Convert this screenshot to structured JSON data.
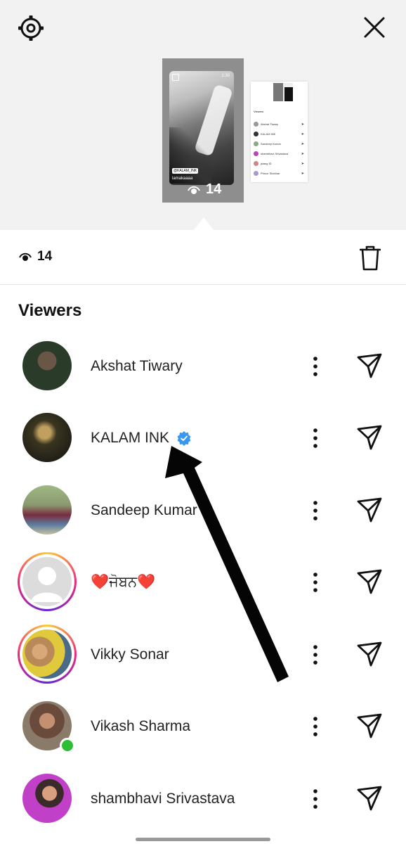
{
  "story": {
    "views": "14",
    "tag": "@KALAM_INK",
    "user": "lamakaaaa",
    "time": "1:30"
  },
  "mini_preview": {
    "title": "Viewers",
    "items": [
      "Akshat Tiwary",
      "KALAM INK",
      "Sandeep Kumar",
      "shambhavi Srivastava",
      "jsiang ID",
      "Prince Shekhar"
    ]
  },
  "stats": {
    "views": "14"
  },
  "viewers_title": "Viewers",
  "viewers": [
    {
      "name": "Akshat Tiwary",
      "verified": false,
      "ring": false,
      "online": false,
      "avatar_color": "#4a5a45"
    },
    {
      "name": "KALAM INK",
      "verified": true,
      "ring": false,
      "online": false,
      "avatar_color": "#2b2a1f"
    },
    {
      "name": "Sandeep Kumar",
      "verified": false,
      "ring": false,
      "online": false,
      "avatar_color": "#8aa070"
    },
    {
      "name": "❤️ਜੋਬਨ❤️",
      "verified": false,
      "ring": true,
      "online": false,
      "avatar_color": "#d9d9d9"
    },
    {
      "name": "Vikky Sonar",
      "verified": false,
      "ring": true,
      "online": false,
      "avatar_color": "#c79a6a"
    },
    {
      "name": "Vikash Sharma",
      "verified": false,
      "ring": false,
      "online": true,
      "avatar_color": "#6d5a4e"
    },
    {
      "name": "shambhavi Srivastava",
      "verified": false,
      "ring": false,
      "online": false,
      "avatar_color": "#b04ab8"
    }
  ],
  "colors": {
    "verified": "#3897f0",
    "online": "#2dbe35",
    "ring_start": "#f9ce34",
    "ring_end": "#ee2a7b"
  },
  "icons": {
    "settings": "gear-icon",
    "close": "close-icon",
    "eye": "eye-icon",
    "delete": "trash-icon",
    "more": "more-vertical-icon",
    "send": "send-icon"
  }
}
